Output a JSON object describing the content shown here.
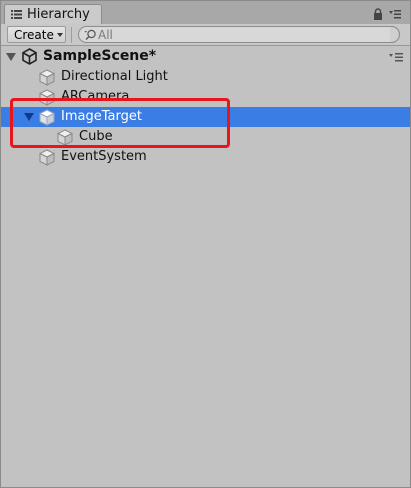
{
  "window": {
    "tab_label": "Hierarchy",
    "tab_icon": "list-icon",
    "lock_icon": "lock-icon",
    "menu_icon": "context-menu-icon"
  },
  "toolbar": {
    "create_label": "Create",
    "search_placeholder": "All",
    "search_value": ""
  },
  "scene": {
    "name": "SampleScene*",
    "icon": "unity-logo-icon",
    "expanded": true
  },
  "tree": {
    "items": [
      {
        "label": "Directional Light",
        "icon": "gameobject-cube-icon",
        "depth": 1,
        "selected": false
      },
      {
        "label": "ARCamera",
        "icon": "gameobject-cube-icon",
        "depth": 1,
        "selected": false
      },
      {
        "label": "ImageTarget",
        "icon": "gameobject-cube-icon",
        "depth": 1,
        "selected": true,
        "expanded": true
      },
      {
        "label": "Cube",
        "icon": "gameobject-cube-icon",
        "depth": 2,
        "selected": false
      },
      {
        "label": "EventSystem",
        "icon": "gameobject-cube-icon",
        "depth": 1,
        "selected": false
      }
    ]
  },
  "colors": {
    "panel_bg": "#c2c2c2",
    "selection": "#3a7ee5",
    "annotation_outline": "#e8161a"
  }
}
